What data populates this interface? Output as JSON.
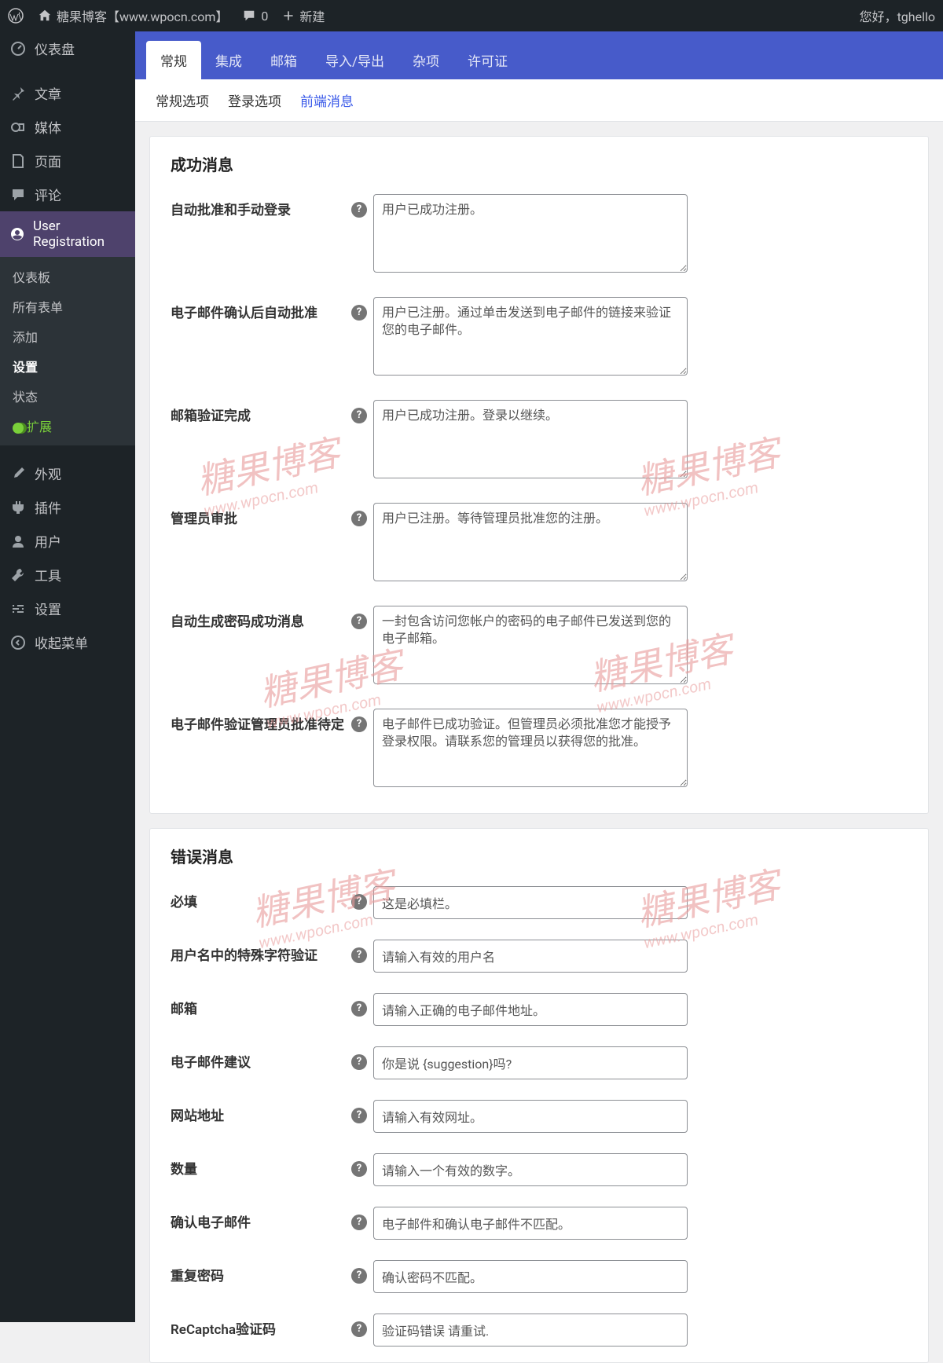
{
  "adminbar": {
    "site_title": "糖果博客【www.wpocn.com】",
    "comments": "0",
    "new": "新建",
    "greeting": "您好，tghello"
  },
  "sidebar": {
    "dashboard": "仪表盘",
    "posts": "文章",
    "media": "媒体",
    "pages": "页面",
    "comments": "评论",
    "user_registration": "User Registration",
    "submenu": {
      "dashboard": "仪表板",
      "all_forms": "所有表单",
      "add": "添加",
      "settings": "设置",
      "status": "状态",
      "extensions": "扩展"
    },
    "appearance": "外观",
    "plugins": "插件",
    "users": "用户",
    "tools": "工具",
    "settings": "设置",
    "collapse": "收起菜单"
  },
  "tabs_primary": {
    "general": "常规",
    "integration": "集成",
    "email": "邮箱",
    "import_export": "导入/导出",
    "misc": "杂项",
    "license": "许可证"
  },
  "tabs_secondary": {
    "general_options": "常规选项",
    "login_options": "登录选项",
    "frontend_messages": "前端消息"
  },
  "success_section": {
    "title": "成功消息",
    "fields": {
      "manual_login": {
        "label": "自动批准和手动登录",
        "value": "用户已成功注册。"
      },
      "email_confirm": {
        "label": "电子邮件确认后自动批准",
        "value": "用户已注册。通过单击发送到电子邮件的链接来验证您的电子邮件。"
      },
      "email_verified": {
        "label": "邮箱验证完成",
        "value": "用户已成功注册。登录以继续。"
      },
      "admin_approval": {
        "label": "管理员审批",
        "value": "用户已注册。等待管理员批准您的注册。"
      },
      "auto_password": {
        "label": "自动生成密码成功消息",
        "value": "一封包含访问您帐户的密码的电子邮件已发送到您的电子邮箱。"
      },
      "email_admin_pending": {
        "label": "电子邮件验证管理员批准待定",
        "value": "电子邮件已成功验证。但管理员必须批准您才能授予登录权限。请联系您的管理员以获得您的批准。"
      }
    }
  },
  "error_section": {
    "title": "错误消息",
    "fields": {
      "required": {
        "label": "必填",
        "value": "这是必填栏。"
      },
      "username_special": {
        "label": "用户名中的特殊字符验证",
        "value": "请输入有效的用户名"
      },
      "email": {
        "label": "邮箱",
        "value": "请输入正确的电子邮件地址。"
      },
      "email_suggestion": {
        "label": "电子邮件建议",
        "value": "你是说 {suggestion}吗?"
      },
      "website": {
        "label": "网站地址",
        "value": "请输入有效网址。"
      },
      "number": {
        "label": "数量",
        "value": "请输入一个有效的数字。"
      },
      "confirm_email": {
        "label": "确认电子邮件",
        "value": "电子邮件和确认电子邮件不匹配。"
      },
      "confirm_password": {
        "label": "重复密码",
        "value": "确认密码不匹配。"
      },
      "recaptcha": {
        "label": "ReCaptcha验证码",
        "value": "验证码错误 请重试."
      }
    }
  },
  "watermark": {
    "text": "糖果博客",
    "url": "www.wpocn.com"
  }
}
